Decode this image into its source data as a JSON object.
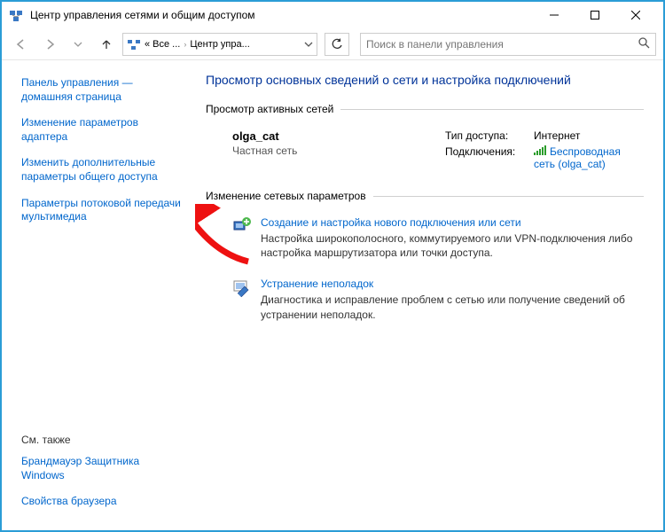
{
  "titlebar": {
    "title": "Центр управления сетями и общим доступом"
  },
  "toolbar": {
    "breadcrumb_prefix": "« Все ...",
    "breadcrumb_current": "Центр упра...",
    "search_placeholder": "Поиск в панели управления"
  },
  "sidebar": {
    "links": [
      "Панель управления — домашняя страница",
      "Изменение параметров адаптера",
      "Изменить дополнительные параметры общего доступа",
      "Параметры потоковой передачи мультимедиа"
    ],
    "see_also_heading": "См. также",
    "see_also_links": [
      "Брандмауэр Защитника Windows",
      "Свойства браузера"
    ]
  },
  "main": {
    "page_title": "Просмотр основных сведений о сети и настройка подключений",
    "active_networks_header": "Просмотр активных сетей",
    "network": {
      "name": "olga_cat",
      "type": "Частная сеть",
      "access_label": "Тип доступа:",
      "access_value": "Интернет",
      "conn_label": "Подключения:",
      "conn_value": "Беспроводная сеть (olga_cat)"
    },
    "change_settings_header": "Изменение сетевых параметров",
    "actions": [
      {
        "title": "Создание и настройка нового подключения или сети",
        "desc": "Настройка широкополосного, коммутируемого или VPN-подключения либо настройка маршрутизатора или точки доступа."
      },
      {
        "title": "Устранение неполадок",
        "desc": "Диагностика и исправление проблем с сетью или получение сведений об устранении неполадок."
      }
    ]
  }
}
